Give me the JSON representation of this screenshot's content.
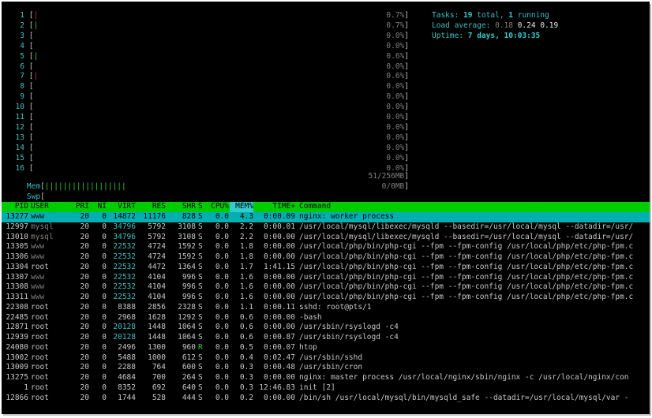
{
  "cpus": [
    {
      "label": "1",
      "pct": "0.7%",
      "bar": "|",
      "bar_color": "red"
    },
    {
      "label": "2",
      "pct": "0.7%",
      "bar": "|",
      "bar_color": "green"
    },
    {
      "label": "3",
      "pct": "0.0%",
      "bar": "",
      "bar_color": ""
    },
    {
      "label": "4",
      "pct": "0.0%",
      "bar": "",
      "bar_color": ""
    },
    {
      "label": "5",
      "pct": "0.6%",
      "bar": "|",
      "bar_color": "green"
    },
    {
      "label": "6",
      "pct": "0.0%",
      "bar": "",
      "bar_color": ""
    },
    {
      "label": "7",
      "pct": "0.6%",
      "bar": "|",
      "bar_color": "red"
    },
    {
      "label": "8",
      "pct": "0.0%",
      "bar": "",
      "bar_color": ""
    },
    {
      "label": "9",
      "pct": "0.0%",
      "bar": "",
      "bar_color": ""
    },
    {
      "label": "10",
      "pct": "0.0%",
      "bar": "",
      "bar_color": ""
    },
    {
      "label": "11",
      "pct": "0.0%",
      "bar": "",
      "bar_color": ""
    },
    {
      "label": "12",
      "pct": "0.0%",
      "bar": "",
      "bar_color": ""
    },
    {
      "label": "13",
      "pct": "0.0%",
      "bar": "",
      "bar_color": ""
    },
    {
      "label": "14",
      "pct": "0.0%",
      "bar": "",
      "bar_color": ""
    },
    {
      "label": "15",
      "pct": "0.0%",
      "bar": "",
      "bar_color": ""
    },
    {
      "label": "16",
      "pct": "0.0%",
      "bar": "",
      "bar_color": ""
    }
  ],
  "mem": {
    "label": "Mem",
    "bar": "||||||||||||||||||",
    "value": "51/256MB"
  },
  "swp": {
    "label": "Swp",
    "bar": "",
    "value": "0/0MB"
  },
  "info": {
    "tasks_label": "Tasks: ",
    "tasks_total": "19",
    "tasks_total_suffix": " total, ",
    "tasks_running": "1",
    "tasks_running_suffix": " running",
    "load_label": "Load average: ",
    "load_1": "0.18",
    "load_5": "0.24",
    "load_15": "0.19",
    "uptime_label": "Uptime: ",
    "uptime_value": "7 days, 10:03:35"
  },
  "columns": [
    "PID",
    "USER",
    "PRI",
    "NI",
    "VIRT",
    "RES",
    "SHR",
    "S",
    "CPU%",
    "MEM%",
    "TIME+",
    "Command"
  ],
  "processes": [
    {
      "pid": "13277",
      "user": "www",
      "pri": "20",
      "ni": "0",
      "virt": "14872",
      "res": "11176",
      "shr": "828",
      "s": "S",
      "cpu": "0.0",
      "mem": "4.3",
      "time": "0:00.09",
      "cmd": "nginx: worker process",
      "selected": true
    },
    {
      "pid": "12997",
      "user": "mysql",
      "pri": "20",
      "ni": "0",
      "virt": "34796",
      "res": "5792",
      "shr": "3108",
      "s": "S",
      "cpu": "0.0",
      "mem": "2.2",
      "time": "0:00.01",
      "cmd": "/usr/local/mysql/libexec/mysqld --basedir=/usr/local/mysql --datadir=/usr/"
    },
    {
      "pid": "13010",
      "user": "mysql",
      "pri": "20",
      "ni": "0",
      "virt": "34796",
      "res": "5792",
      "shr": "3108",
      "s": "S",
      "cpu": "0.0",
      "mem": "2.2",
      "time": "0:00.00",
      "cmd": "/usr/local/mysql/libexec/mysqld --basedir=/usr/local/mysql --datadir=/usr/"
    },
    {
      "pid": "13305",
      "user": "www",
      "pri": "20",
      "ni": "0",
      "virt": "22532",
      "res": "4724",
      "shr": "1592",
      "s": "S",
      "cpu": "0.0",
      "mem": "1.8",
      "time": "0:00.00",
      "cmd": "/usr/local/php/bin/php-cgi --fpm --fpm-config /usr/local/php/etc/php-fpm.c"
    },
    {
      "pid": "13306",
      "user": "www",
      "pri": "20",
      "ni": "0",
      "virt": "22532",
      "res": "4724",
      "shr": "1592",
      "s": "S",
      "cpu": "0.0",
      "mem": "1.8",
      "time": "0:00.00",
      "cmd": "/usr/local/php/bin/php-cgi --fpm --fpm-config /usr/local/php/etc/php-fpm.c"
    },
    {
      "pid": "13304",
      "user": "root",
      "pri": "20",
      "ni": "0",
      "virt": "22532",
      "res": "4472",
      "shr": "1364",
      "s": "S",
      "cpu": "0.0",
      "mem": "1.7",
      "time": "1:41.15",
      "cmd": "/usr/local/php/bin/php-cgi --fpm --fpm-config /usr/local/php/etc/php-fpm.c"
    },
    {
      "pid": "13307",
      "user": "www",
      "pri": "20",
      "ni": "0",
      "virt": "22532",
      "res": "4104",
      "shr": "996",
      "s": "S",
      "cpu": "0.0",
      "mem": "1.6",
      "time": "0:00.00",
      "cmd": "/usr/local/php/bin/php-cgi --fpm --fpm-config /usr/local/php/etc/php-fpm.c"
    },
    {
      "pid": "13308",
      "user": "www",
      "pri": "20",
      "ni": "0",
      "virt": "22532",
      "res": "4104",
      "shr": "996",
      "s": "S",
      "cpu": "0.0",
      "mem": "1.6",
      "time": "0:00.00",
      "cmd": "/usr/local/php/bin/php-cgi --fpm --fpm-config /usr/local/php/etc/php-fpm.c"
    },
    {
      "pid": "13311",
      "user": "www",
      "pri": "20",
      "ni": "0",
      "virt": "22532",
      "res": "4104",
      "shr": "996",
      "s": "S",
      "cpu": "0.0",
      "mem": "1.6",
      "time": "0:00.00",
      "cmd": "/usr/local/php/bin/php-cgi --fpm --fpm-config /usr/local/php/etc/php-fpm.c"
    },
    {
      "pid": "22308",
      "user": "root",
      "pri": "20",
      "ni": "0",
      "virt": "8388",
      "res": "2856",
      "shr": "2328",
      "s": "S",
      "cpu": "0.0",
      "mem": "1.1",
      "time": "0:00.11",
      "cmd": "sshd: root@pts/1"
    },
    {
      "pid": "22485",
      "user": "root",
      "pri": "20",
      "ni": "0",
      "virt": "2968",
      "res": "1628",
      "shr": "1292",
      "s": "S",
      "cpu": "0.0",
      "mem": "0.6",
      "time": "0:00.00",
      "cmd": "-bash"
    },
    {
      "pid": "12871",
      "user": "root",
      "pri": "20",
      "ni": "0",
      "virt": "20128",
      "res": "1448",
      "shr": "1064",
      "s": "S",
      "cpu": "0.0",
      "mem": "0.6",
      "time": "0:00.00",
      "cmd": "/usr/sbin/rsyslogd -c4"
    },
    {
      "pid": "12939",
      "user": "root",
      "pri": "20",
      "ni": "0",
      "virt": "20128",
      "res": "1448",
      "shr": "1064",
      "s": "S",
      "cpu": "0.0",
      "mem": "0.6",
      "time": "0:00.87",
      "cmd": "/usr/sbin/rsyslogd -c4"
    },
    {
      "pid": "24080",
      "user": "root",
      "pri": "20",
      "ni": "0",
      "virt": "2496",
      "res": "1300",
      "shr": "960",
      "s": "R",
      "cpu": "0.0",
      "mem": "0.5",
      "time": "0:00.07",
      "cmd": "htop"
    },
    {
      "pid": "13002",
      "user": "root",
      "pri": "20",
      "ni": "0",
      "virt": "5488",
      "res": "1000",
      "shr": "612",
      "s": "S",
      "cpu": "0.0",
      "mem": "0.4",
      "time": "0:02.47",
      "cmd": "/usr/sbin/sshd"
    },
    {
      "pid": "13009",
      "user": "root",
      "pri": "20",
      "ni": "0",
      "virt": "2288",
      "res": "764",
      "shr": "600",
      "s": "S",
      "cpu": "0.0",
      "mem": "0.3",
      "time": "0:00.48",
      "cmd": "/usr/sbin/cron"
    },
    {
      "pid": "13275",
      "user": "root",
      "pri": "20",
      "ni": "0",
      "virt": "4684",
      "res": "700",
      "shr": "264",
      "s": "S",
      "cpu": "0.0",
      "mem": "0.3",
      "time": "0:00.00",
      "cmd": "nginx: master process /usr/local/nginx/sbin/nginx -c /usr/local/nginx/con"
    },
    {
      "pid": "1",
      "user": "root",
      "pri": "20",
      "ni": "0",
      "virt": "8352",
      "res": "692",
      "shr": "640",
      "s": "S",
      "cpu": "0.0",
      "mem": "0.3",
      "time": "12:46.83",
      "cmd": "init [2]"
    },
    {
      "pid": "12866",
      "user": "root",
      "pri": "20",
      "ni": "0",
      "virt": "1744",
      "res": "528",
      "shr": "444",
      "s": "S",
      "cpu": "0.0",
      "mem": "0.2",
      "time": "0:00.00",
      "cmd": "/bin/sh /usr/local/mysql/bin/mysqld_safe --datadir=/usr/local/mysql/var -"
    }
  ],
  "colors": {
    "meter_label": "#3fbfbf",
    "bar_green": "#33cc33",
    "bar_red": "#cc3333",
    "header_bg": "#00cc00",
    "selected_bg": "#00b0b0"
  }
}
